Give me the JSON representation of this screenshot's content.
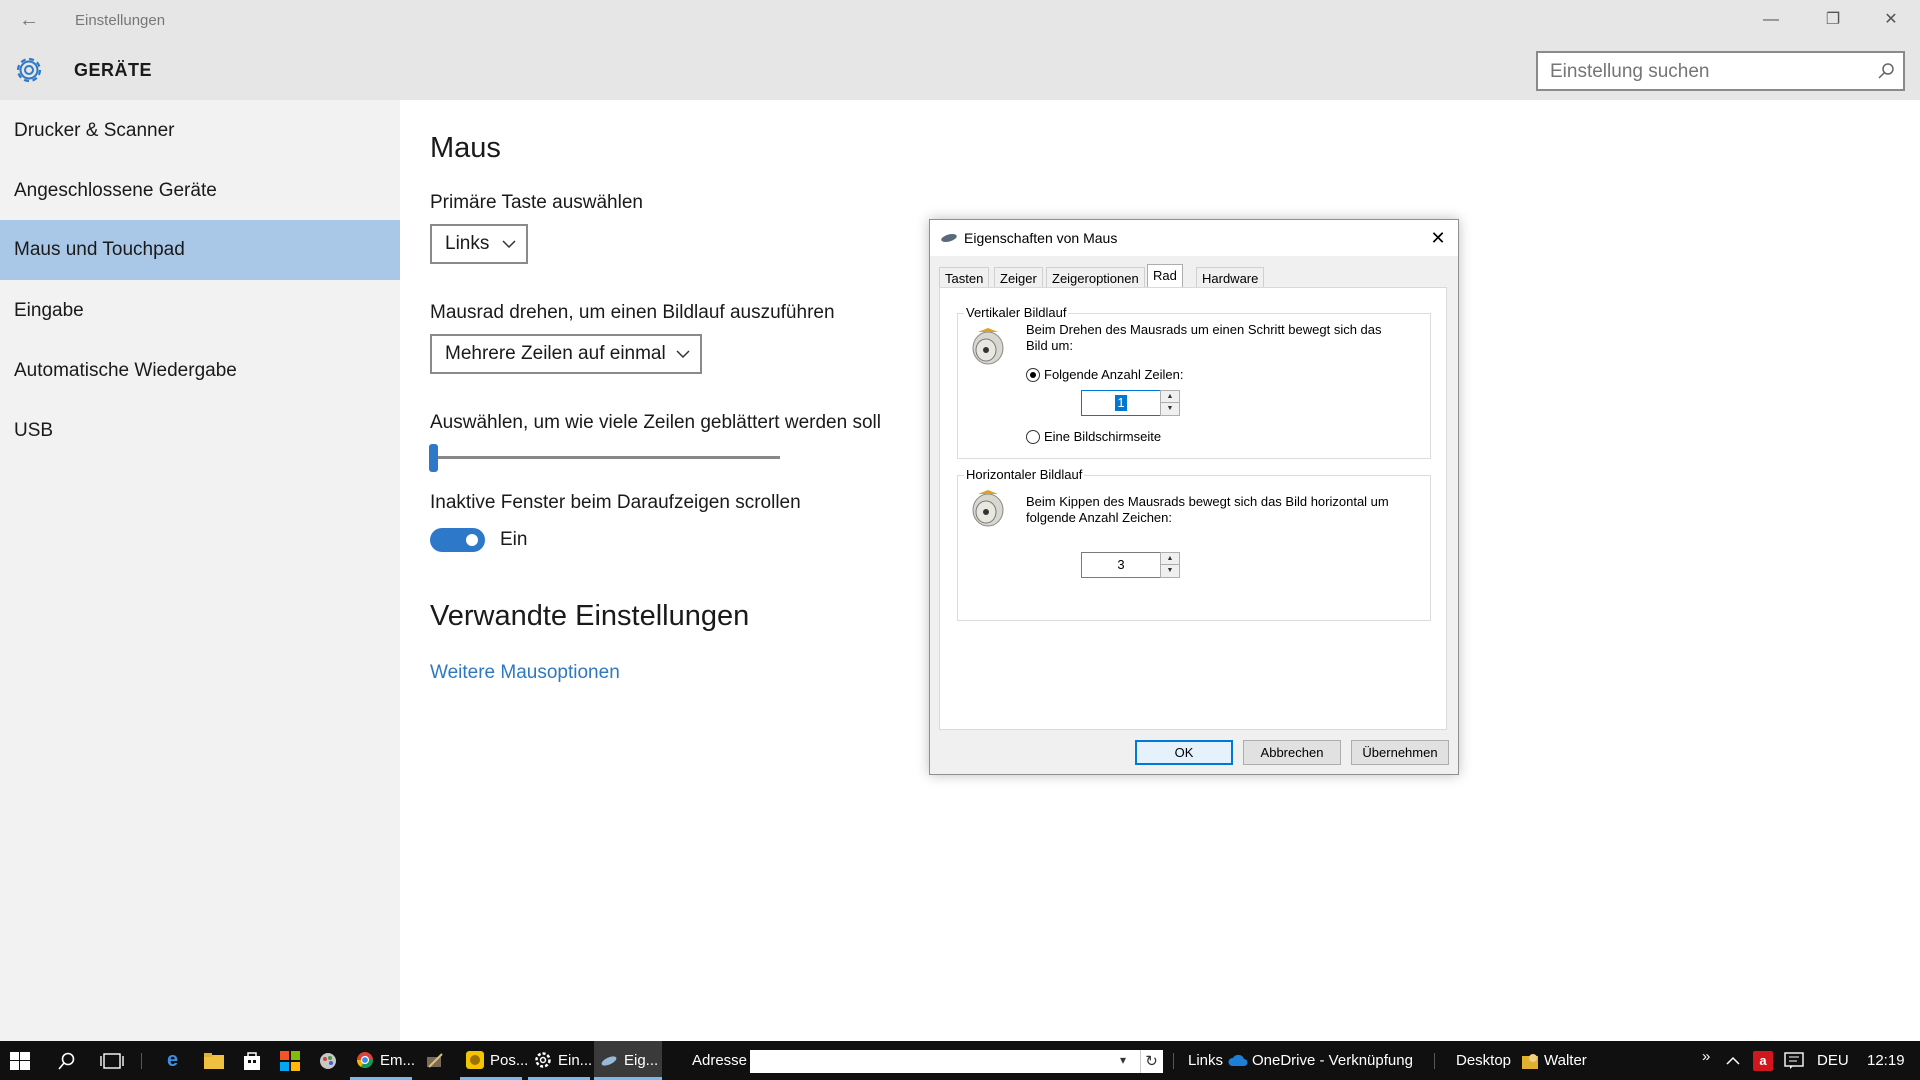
{
  "window": {
    "title": "Einstellungen",
    "minimize": "—",
    "maximize": "❐",
    "close": "✕"
  },
  "header": {
    "title": "GERÄTE",
    "search_placeholder": "Einstellung suchen"
  },
  "sidebar": {
    "items": [
      {
        "label": "Drucker & Scanner"
      },
      {
        "label": "Angeschlossene Geräte"
      },
      {
        "label": "Maus und Touchpad",
        "active": true
      },
      {
        "label": "Eingabe"
      },
      {
        "label": "Automatische Wiedergabe"
      },
      {
        "label": "USB"
      }
    ]
  },
  "main": {
    "title": "Maus",
    "primary_button_label": "Primäre Taste auswählen",
    "primary_button_value": "Links",
    "scroll_label": "Mausrad drehen, um einen Bildlauf auszuführen",
    "scroll_value": "Mehrere Zeilen auf einmal",
    "lines_label": "Auswählen, um wie viele Zeilen geblättert werden soll",
    "lines_slider_value": 1,
    "inactive_label": "Inaktive Fenster beim Daraufzeigen scrollen",
    "inactive_toggle": true,
    "inactive_state": "Ein",
    "related_title": "Verwandte Einstellungen",
    "related_link": "Weitere Mausoptionen"
  },
  "dialog": {
    "title": "Eigenschaften von Maus",
    "tabs": [
      "Tasten",
      "Zeiger",
      "Zeigeroptionen",
      "Rad",
      "Hardware"
    ],
    "active_tab": "Rad",
    "vertical": {
      "title": "Vertikaler Bildlauf",
      "description": "Beim Drehen des Mausrads um einen Schritt bewegt sich das Bild um:",
      "option_lines": "Folgende Anzahl Zeilen:",
      "lines_value": "1",
      "option_page": "Eine Bildschirmseite",
      "selected": "lines"
    },
    "horizontal": {
      "title": "Horizontaler Bildlauf",
      "description": "Beim Kippen des Mausrads bewegt sich das Bild horizontal um folgende Anzahl Zeichen:",
      "chars_value": "3"
    },
    "buttons": {
      "ok": "OK",
      "cancel": "Abbrechen",
      "apply": "Übernehmen"
    }
  },
  "taskbar": {
    "apps": [
      {
        "label": "Em...",
        "color": "#db4437",
        "open": true
      },
      {
        "label": "Pos...",
        "color": "#f5c400",
        "open": true
      },
      {
        "label": "Ein...",
        "color": "#ffffff",
        "open": true
      },
      {
        "label": "Eig...",
        "color": "#4a9ee0",
        "open": true,
        "active": true
      }
    ],
    "address_label": "Adresse",
    "links_label": "Links",
    "onedrive_label": "OneDrive - Verknüpfung",
    "desktop_label": "Desktop",
    "user_label": "Walter",
    "language": "DEU",
    "time": "12:19",
    "overflow": "»"
  }
}
